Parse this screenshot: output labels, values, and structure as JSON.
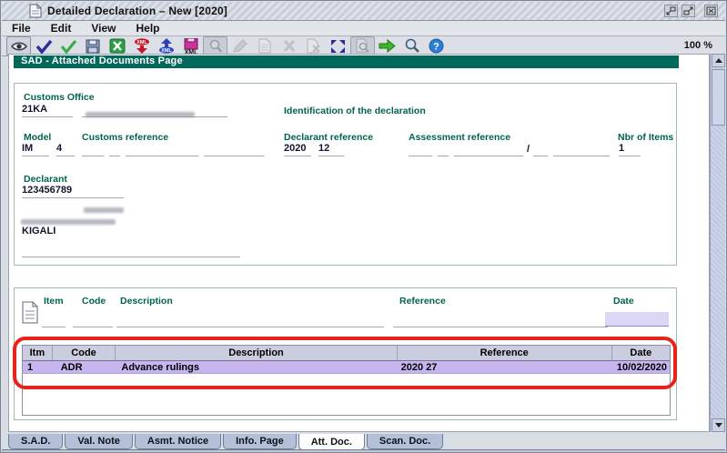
{
  "titlebar": {
    "title": "Detailed Declaration – New [2020]"
  },
  "menubar": {
    "items": [
      "File",
      "Edit",
      "View",
      "Help"
    ]
  },
  "toolbar": {
    "zoom_level": "100 %",
    "icons": [
      "view",
      "validate",
      "verify",
      "save",
      "export-excel",
      "xml-export",
      "xml-import",
      "xml-save",
      "preview",
      "edit",
      "copy-document",
      "delete",
      "remove-document",
      "expand-items",
      "print-preview",
      "forward",
      "zoom",
      "help"
    ]
  },
  "page_header": {
    "title": "SAD - Attached Documents Page"
  },
  "declaration_form": {
    "customs_office_label": "Customs Office",
    "customs_office_code": "21KA",
    "identification_label": "Identification of the declaration",
    "model_label": "Model",
    "model_type": "IM",
    "model_procedure": "4",
    "customs_reference_label": "Customs reference",
    "declarant_reference_label": "Declarant reference",
    "declarant_reference_year": "2020",
    "declarant_reference_number": "12",
    "assessment_reference_label": "Assessment reference",
    "assessment_reference_separator": "/",
    "nbr_of_items_label": "Nbr of Items",
    "nbr_of_items": "1",
    "declarant_label": "Declarant",
    "declarant_code": "123456789",
    "declarant_city": "KIGALI"
  },
  "attached_documents": {
    "item_label": "Item",
    "code_label": "Code",
    "description_label": "Description",
    "reference_label": "Reference",
    "date_label": "Date",
    "table": {
      "headers": [
        "Itm",
        "Code",
        "Description",
        "Reference",
        "Date"
      ],
      "rows": [
        {
          "itm": "1",
          "code": "ADR",
          "description": "Advance rulings",
          "reference": "2020 27",
          "date": "10/02/2020"
        }
      ]
    }
  },
  "tabs": {
    "active": "Att. Doc.",
    "items": [
      {
        "label": "S.A.D."
      },
      {
        "label": "Val. Note"
      },
      {
        "label": "Asmt. Notice"
      },
      {
        "label": "Info. Page"
      },
      {
        "label": "Att. Doc."
      },
      {
        "label": "Scan. Doc."
      }
    ]
  },
  "annotation": {
    "highlight_color": "#e8221c"
  }
}
